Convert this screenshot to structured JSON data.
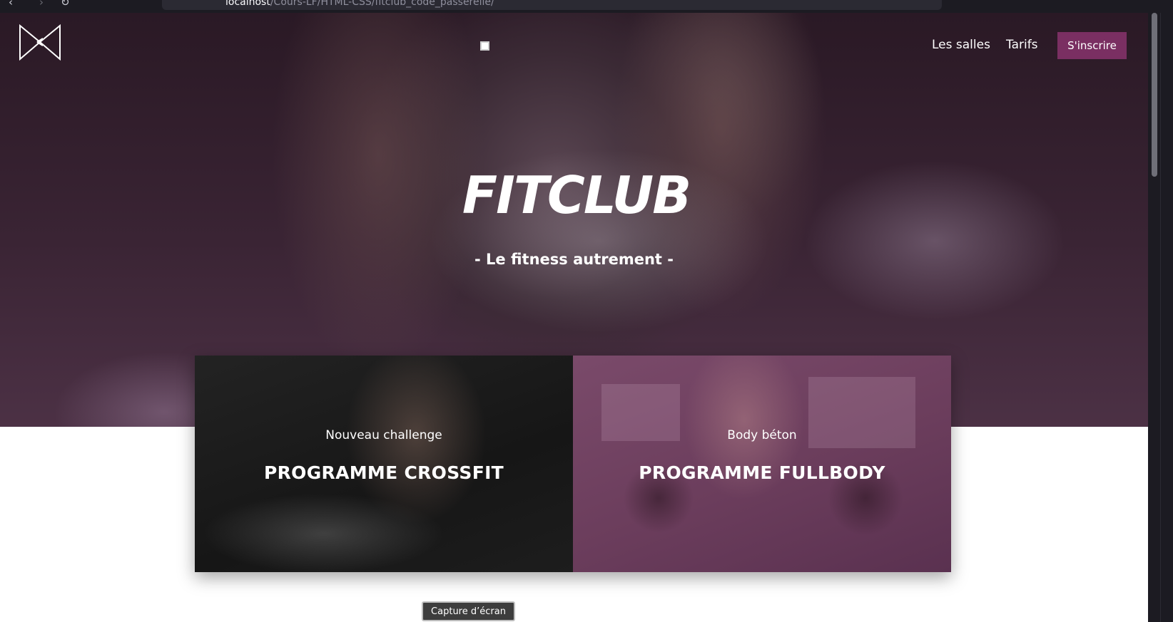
{
  "browser": {
    "url_host": "localhost",
    "url_path": "/Cours-LF/HTML-CSS/fitclub_code_passerelle/"
  },
  "nav": {
    "links": [
      "Les salles",
      "Tarifs"
    ],
    "signup_label": "S'inscrire"
  },
  "hero": {
    "title": "FITCLUB",
    "subtitle": "- Le fitness autrement -"
  },
  "programs": [
    {
      "kicker": "Nouveau challenge",
      "title": "PROGRAMME CROSSFIT"
    },
    {
      "kicker": "Body béton",
      "title": "PROGRAMME FULLBODY"
    }
  ],
  "overlay": {
    "screenshot_label": "Capture d’écran"
  },
  "colors": {
    "accent": "#7a2f62",
    "hero_base": "#2a1925"
  }
}
